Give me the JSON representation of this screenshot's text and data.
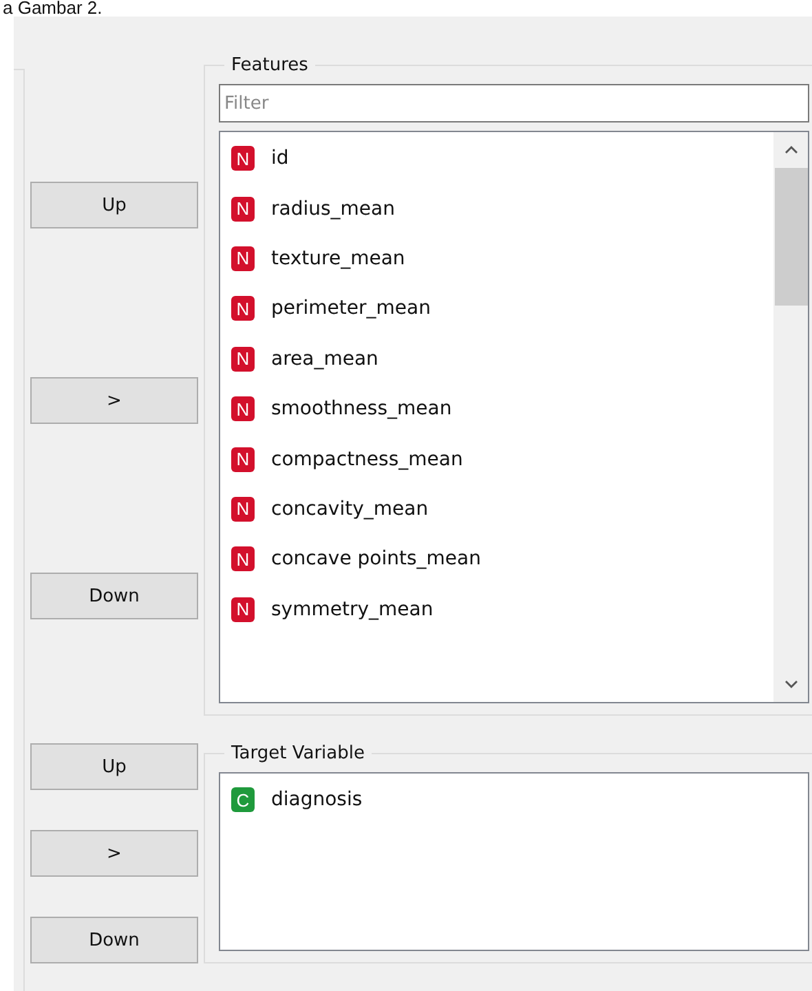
{
  "caption": "a Gambar 2.",
  "features": {
    "title": "Features",
    "filter": {
      "placeholder": "Filter"
    },
    "buttons": [
      "Up",
      ">",
      "Down"
    ],
    "items": [
      {
        "kind": "numeric",
        "badge": "N",
        "name": "id"
      },
      {
        "kind": "numeric",
        "badge": "N",
        "name": "radius_mean"
      },
      {
        "kind": "numeric",
        "badge": "N",
        "name": "texture_mean"
      },
      {
        "kind": "numeric",
        "badge": "N",
        "name": "perimeter_mean"
      },
      {
        "kind": "numeric",
        "badge": "N",
        "name": "area_mean"
      },
      {
        "kind": "numeric",
        "badge": "N",
        "name": "smoothness_mean"
      },
      {
        "kind": "numeric",
        "badge": "N",
        "name": "compactness_mean"
      },
      {
        "kind": "numeric",
        "badge": "N",
        "name": "concavity_mean"
      },
      {
        "kind": "numeric",
        "badge": "N",
        "name": "concave points_mean"
      },
      {
        "kind": "numeric",
        "badge": "N",
        "name": "symmetry_mean"
      }
    ]
  },
  "target": {
    "title": "Target Variable",
    "buttons": [
      "Up",
      ">",
      "Down"
    ],
    "items": [
      {
        "kind": "categorical",
        "badge": "C",
        "name": "diagnosis"
      }
    ]
  }
}
